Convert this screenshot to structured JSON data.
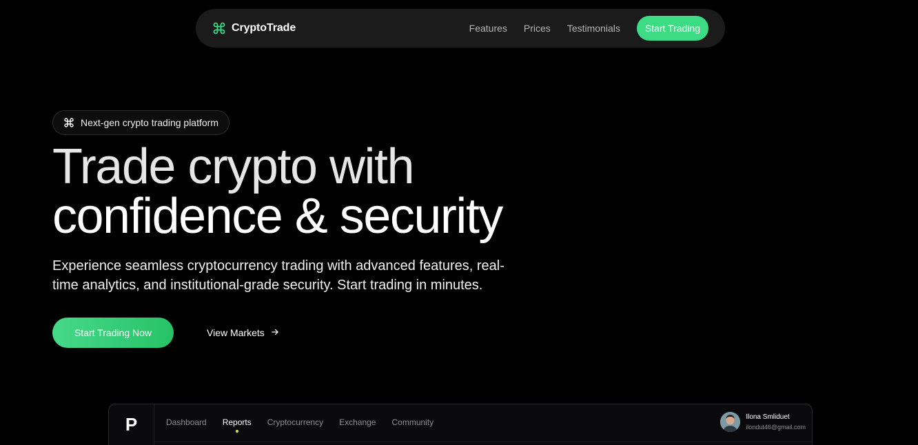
{
  "nav": {
    "brand": "CryptoTrade",
    "links": [
      "Features",
      "Prices",
      "Testimonials"
    ],
    "cta": "Start Trading"
  },
  "hero": {
    "badge": "Next-gen crypto trading platform",
    "title_line1": "Trade crypto with",
    "title_line2": "confidence & security",
    "subtitle": "Experience seamless cryptocurrency trading with advanced features, real-time analytics, and institutional-grade security. Start trading in minutes.",
    "primary_cta": "Start Trading Now",
    "secondary_cta": "View Markets"
  },
  "preview": {
    "logo": "P",
    "tabs": [
      "Dashboard",
      "Reports",
      "Cryptocurrency",
      "Exchange",
      "Community"
    ],
    "active_tab": "Reports",
    "user": {
      "name": "Ilona Smliduet",
      "email": "ilondut46@gmail.com"
    }
  },
  "colors": {
    "accent": "#3ddc84",
    "accent_dark": "#27c266",
    "preview_accent": "#c9f25b",
    "background": "#000000",
    "nav_bg": "#1b1b1b"
  },
  "icons": {
    "brand": "command-icon",
    "badge": "command-icon",
    "secondary_cta": "arrow-right-icon"
  }
}
